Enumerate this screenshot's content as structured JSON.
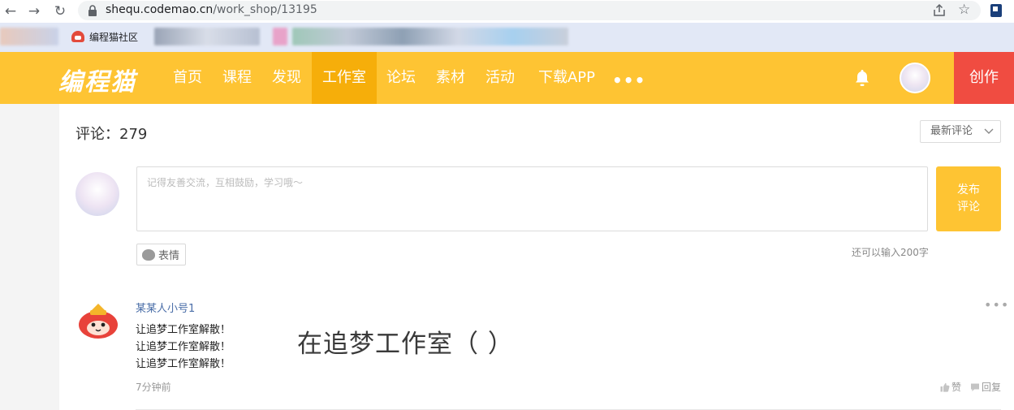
{
  "browser": {
    "url_host": "shequ.codemao.cn",
    "url_path": "/work_shop/13195",
    "bookmark_label": "编程猫社区"
  },
  "header": {
    "logo": "编程猫",
    "nav": [
      {
        "label": "首页",
        "active": false
      },
      {
        "label": "课程",
        "active": false
      },
      {
        "label": "发现",
        "active": false
      },
      {
        "label": "工作室",
        "active": true
      },
      {
        "label": "论坛",
        "active": false
      },
      {
        "label": "素材",
        "active": false
      },
      {
        "label": "活动",
        "active": false
      },
      {
        "label": "下载APP",
        "active": false
      }
    ],
    "more": "•••",
    "create_label": "创作",
    "accent_color": "#fec433",
    "create_color": "#f04c41"
  },
  "comments": {
    "count_label": "评论：279",
    "sort_value": "最新评论",
    "input_placeholder": "记得友善交流，互相鼓励，学习哦～",
    "post_label_line1": "发布",
    "post_label_line2": "评论",
    "emoji_label": "表情",
    "chars_left": "还可以输入200字",
    "items": [
      {
        "user": "某某人小号1",
        "lines": [
          "让追梦工作室解散！",
          "让追梦工作室解散！",
          "让追梦工作室解散！"
        ],
        "time": "7分钟前",
        "like_label": "赞",
        "reply_label": "回复",
        "more": "•••"
      }
    ]
  },
  "overlay_text": "在追梦工作室（  ）"
}
